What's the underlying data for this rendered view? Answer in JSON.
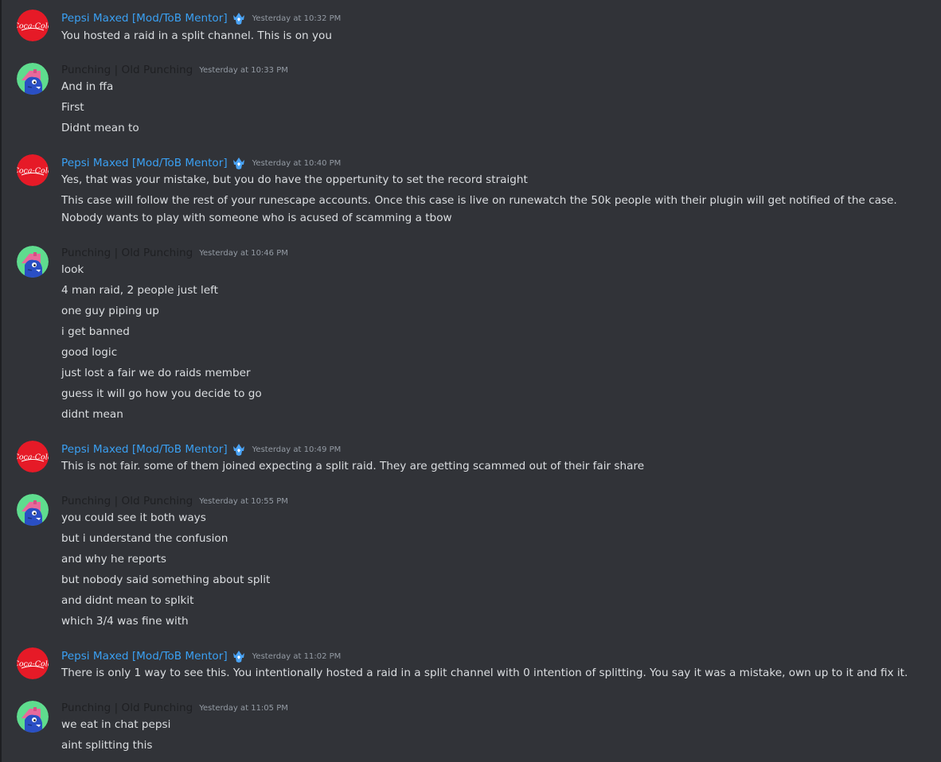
{
  "colors": {
    "background": "#313338",
    "message_text": "#dbdee1",
    "timestamp": "#949ba4",
    "pepsi_name": "#3aa0f3",
    "punching_name": "#1e1f22",
    "badge": "#4aa3f5"
  },
  "users": {
    "pepsi": {
      "name": "Pepsi Maxed [Mod/ToB Mentor]",
      "avatar_icon": "coca-cola-logo-icon",
      "badge_icon": "crown-shield-icon",
      "avatar_text": "Coca-Cola"
    },
    "punching": {
      "name": "Punching | Old Punching",
      "avatar_icon": "cartoon-creature-icon"
    }
  },
  "messages": [
    {
      "user": "pepsi",
      "timestamp": "Yesterday at 10:32 PM",
      "lines": [
        "You hosted a raid in a split channel. This is on you"
      ]
    },
    {
      "user": "punching",
      "timestamp": "Yesterday at 10:33 PM",
      "lines": [
        "And in ffa",
        "First",
        "Didnt mean to"
      ]
    },
    {
      "user": "pepsi",
      "timestamp": "Yesterday at 10:40 PM",
      "lines": [
        "Yes, that was your mistake, but you do have the oppertunity to set the record straight",
        "This case will follow the rest of your runescape accounts. Once this case is live on runewatch the 50k people with their plugin will get notified of the case. Nobody wants to play with someone who is acused of scamming a tbow"
      ]
    },
    {
      "user": "punching",
      "timestamp": "Yesterday at 10:46 PM",
      "lines": [
        "look",
        "4 man raid, 2 people just left",
        "one guy piping up",
        "i get banned",
        "good logic",
        "just lost a fair we do raids member",
        "guess it will go how you decide to go",
        "didnt mean"
      ]
    },
    {
      "user": "pepsi",
      "timestamp": "Yesterday at 10:49 PM",
      "lines": [
        "This is not fair. some of them joined expecting a split raid. They are getting scammed out of their fair share"
      ]
    },
    {
      "user": "punching",
      "timestamp": "Yesterday at 10:55 PM",
      "lines": [
        "you could see it both ways",
        "but i understand the confusion",
        "and why he reports",
        "but nobody said something about split",
        "and didnt mean to splkit",
        "which 3/4 was fine with"
      ]
    },
    {
      "user": "pepsi",
      "timestamp": "Yesterday at 11:02 PM",
      "lines": [
        "There is only 1 way to see this. You intentionally hosted a raid in a split channel with 0 intention of splitting. You say it was a mistake, own up to it and fix it."
      ]
    },
    {
      "user": "punching",
      "timestamp": "Yesterday at 11:05 PM",
      "lines": [
        "we eat in chat pepsi",
        "aint splitting this"
      ]
    }
  ]
}
